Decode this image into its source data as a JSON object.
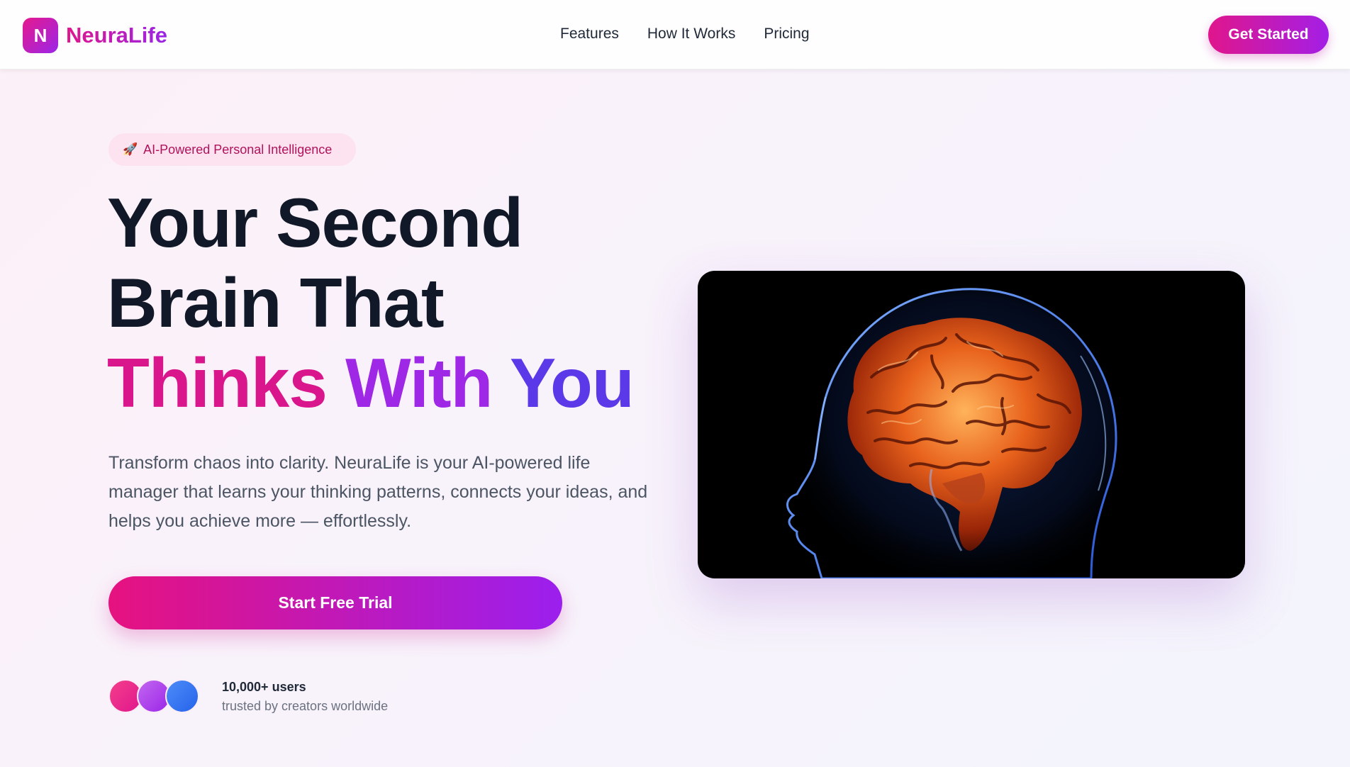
{
  "nav": {
    "logo_letter": "N",
    "brand": "NeuraLife",
    "links": [
      "Features",
      "How It Works",
      "Pricing"
    ],
    "cta": "Get Started"
  },
  "hero": {
    "badge_icon": "rocket-icon",
    "badge_text": "AI-Powered Personal Intelligence",
    "headline_line1": "Your Second",
    "headline_line2": "Brain That",
    "headline_word1": "Thinks",
    "headline_word2": "With",
    "headline_word3": "You",
    "lead": "Transform chaos into clarity. NeuraLife is your AI-powered life manager that learns your thinking patterns, connects your ideas, and helps you achieve more — effortlessly.",
    "cta": "Start Free Trial",
    "proof_title": "10,000+ users",
    "proof_sub": "trusted by creators worldwide"
  },
  "colors": {
    "accent_pink": "#e0168c",
    "accent_purple": "#9b26e8",
    "accent_blue": "#5b39e8"
  }
}
